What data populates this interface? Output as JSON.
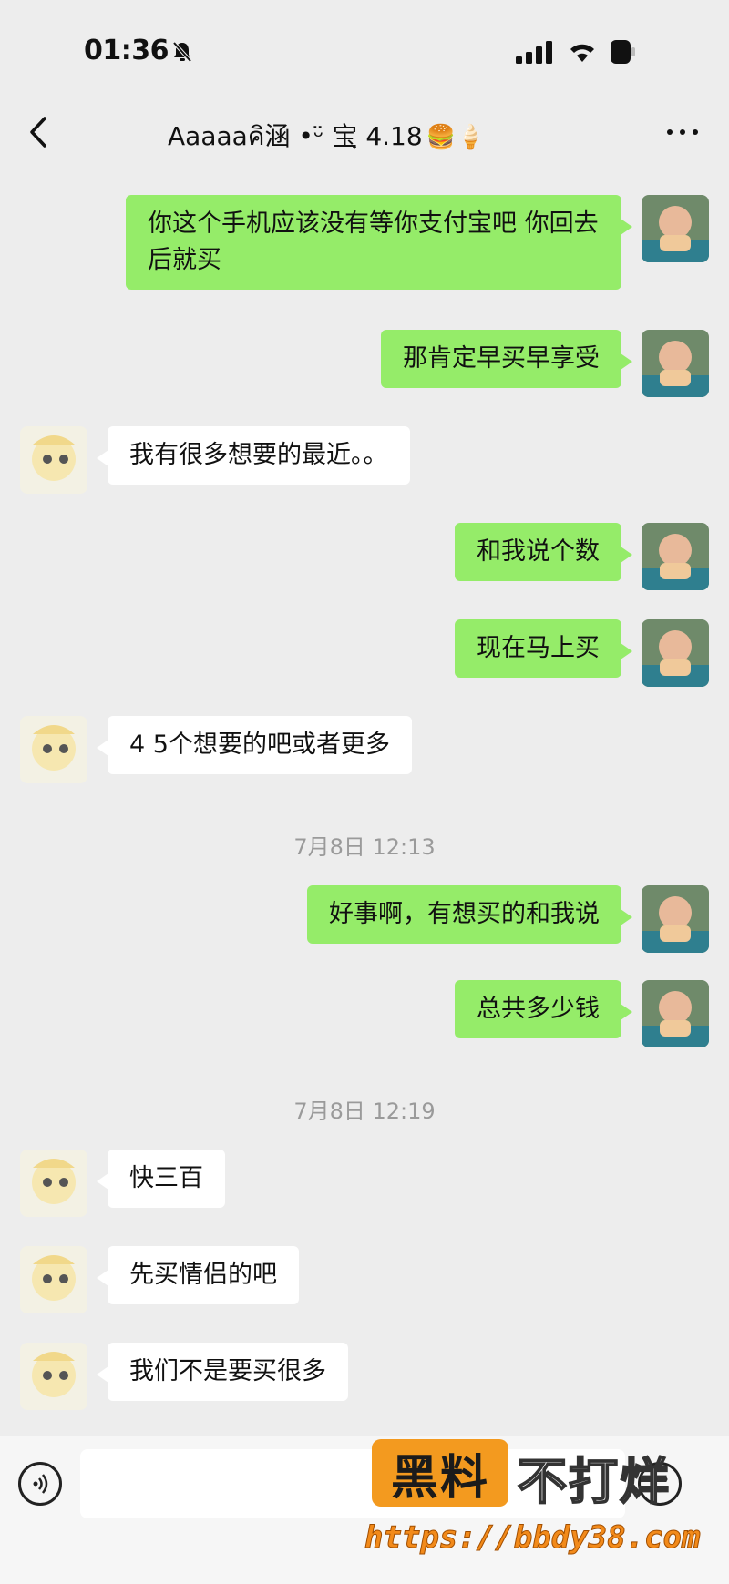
{
  "status_bar": {
    "time": "01:36"
  },
  "header": {
    "title": "Aaaaaคิ涵 •ᵕ̈ 宝ฺ 4.18",
    "title_emojis": "🍔🍦"
  },
  "messages": [
    {
      "side": "out",
      "text": "你这个手机应该没有等你支付宝吧 你回去后就买"
    },
    {
      "side": "out",
      "text": "那肯定早买早享受"
    },
    {
      "side": "in",
      "text": "我有很多想要的最近。。"
    },
    {
      "side": "out",
      "text": "和我说个数"
    },
    {
      "side": "out",
      "text": "现在马上买"
    },
    {
      "side": "in",
      "text": "4 5个想要的吧或者更多"
    },
    {
      "side": "time",
      "text": "7月8日 12:13"
    },
    {
      "side": "out",
      "text": "好事啊，有想买的和我说"
    },
    {
      "side": "out",
      "text": "总共多少钱"
    },
    {
      "side": "time",
      "text": "7月8日 12:19"
    },
    {
      "side": "in",
      "text": "快三百"
    },
    {
      "side": "in",
      "text": "先买情侣的吧"
    },
    {
      "side": "in",
      "text": "我们不是要买很多"
    }
  ],
  "input": {
    "value": "",
    "placeholder": ""
  },
  "watermark": {
    "box_text": "黑料",
    "text": "不打烊",
    "url": "https://bbdy38.com"
  },
  "colors": {
    "outgoing_bubble": "#95ec69",
    "incoming_bubble": "#ffffff",
    "background": "#ededed",
    "watermark_orange": "#f39a1f"
  },
  "icons": [
    "bell-muted-icon",
    "signal-icon",
    "wifi-icon",
    "battery-icon",
    "back-chevron-icon",
    "more-dots-icon",
    "voice-icon",
    "emoji-icon"
  ]
}
